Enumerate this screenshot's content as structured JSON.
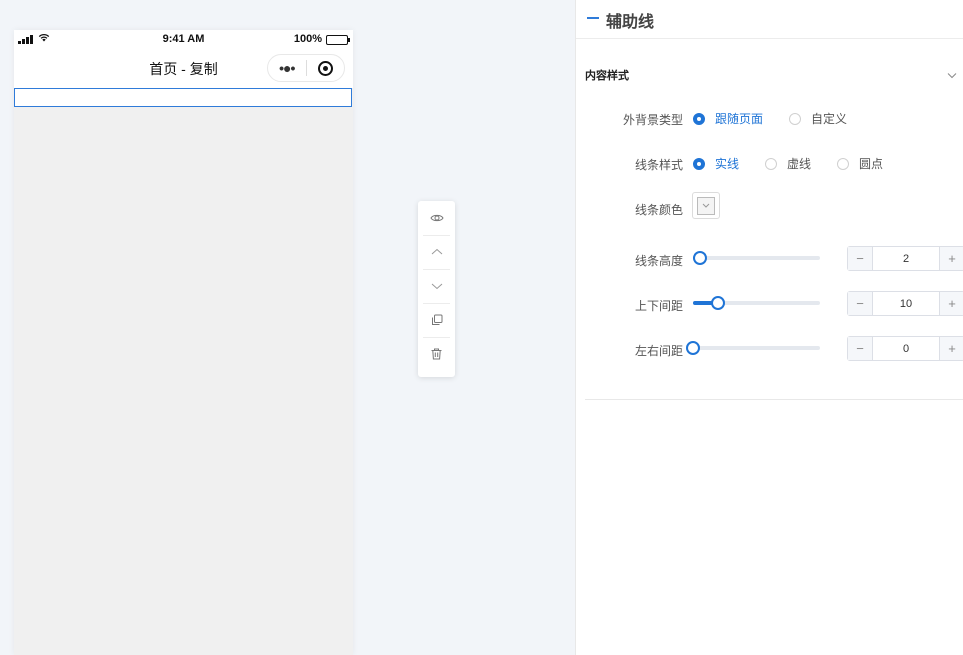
{
  "phone": {
    "status": {
      "time": "9:41 AM",
      "battery": "100%"
    },
    "nav": {
      "title": "首页 - 复制",
      "more": "•●•"
    }
  },
  "toolbar": {
    "items": [
      {
        "icon": "eye-icon",
        "action": "visibility"
      },
      {
        "icon": "chevron-up-icon",
        "action": "move-up"
      },
      {
        "icon": "chevron-down-icon",
        "action": "move-down"
      },
      {
        "icon": "copy-icon",
        "action": "copy"
      },
      {
        "icon": "trash-icon",
        "action": "delete"
      }
    ]
  },
  "panel": {
    "title": "辅助线",
    "section": {
      "title": "内容样式"
    },
    "background": {
      "label": "外背景类型",
      "options": [
        "跟随页面",
        "自定义"
      ],
      "selected": "跟随页面"
    },
    "line_style": {
      "label": "线条样式",
      "options": [
        "实线",
        "虚线",
        "圆点"
      ],
      "selected": "实线"
    },
    "line_color": {
      "label": "线条颜色",
      "value": "#ffffff"
    },
    "line_height": {
      "label": "线条高度",
      "value": "2",
      "min": 1,
      "max": 20
    },
    "vertical_padding": {
      "label": "上下间距",
      "value": "10",
      "min": 0,
      "max": 50
    },
    "horizontal_padding": {
      "label": "左右间距",
      "value": "0",
      "min": 0,
      "max": 50
    },
    "stepper": {
      "minus": "−",
      "plus": "+"
    }
  },
  "colors": {
    "accent": "#1f74d6",
    "selection": "#2f7bd9",
    "canvas_bg": "#f2f5f9"
  }
}
